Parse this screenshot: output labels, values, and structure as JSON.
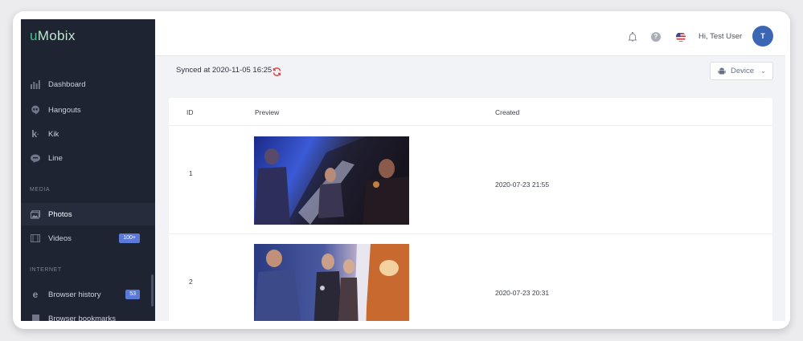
{
  "app": {
    "logo_prefix": "u",
    "logo_rest": "Mobix"
  },
  "sidebar": {
    "items": [
      {
        "label": "Dashboard",
        "icon": "bar-chart-icon"
      },
      {
        "label": "Hangouts",
        "icon": "hangouts-icon"
      },
      {
        "label": "Kik",
        "icon": "kik-icon"
      },
      {
        "label": "Line",
        "icon": "line-icon"
      }
    ],
    "sections": {
      "media": "MEDIA",
      "internet": "INTERNET"
    },
    "media_items": [
      {
        "label": "Photos",
        "icon": "photos-icon",
        "active": true
      },
      {
        "label": "Videos",
        "icon": "video-icon",
        "badge": "100+"
      }
    ],
    "internet_items": [
      {
        "label": "Browser history",
        "icon": "internet-explorer-icon",
        "badge": "53"
      },
      {
        "label": "Browser bookmarks",
        "icon": "bookmark-icon"
      }
    ]
  },
  "topbar": {
    "greeting": "Hi, Test User",
    "avatar_initial": "T"
  },
  "sync": {
    "text": "Synced at 2020-11-05 16:25"
  },
  "device_select": {
    "label": "Device"
  },
  "table": {
    "columns": [
      "ID",
      "Preview",
      "Created"
    ],
    "rows": [
      {
        "id": "1",
        "created": "2020-07-23 21:55"
      },
      {
        "id": "2",
        "created": "2020-07-23 20:31"
      }
    ]
  },
  "colors": {
    "sidebar_bg": "#1f2432",
    "logo_accent": "#4bc08a",
    "badge": "#5b79d6",
    "avatar": "#3a66b4",
    "sync_icon": "#e04848"
  }
}
